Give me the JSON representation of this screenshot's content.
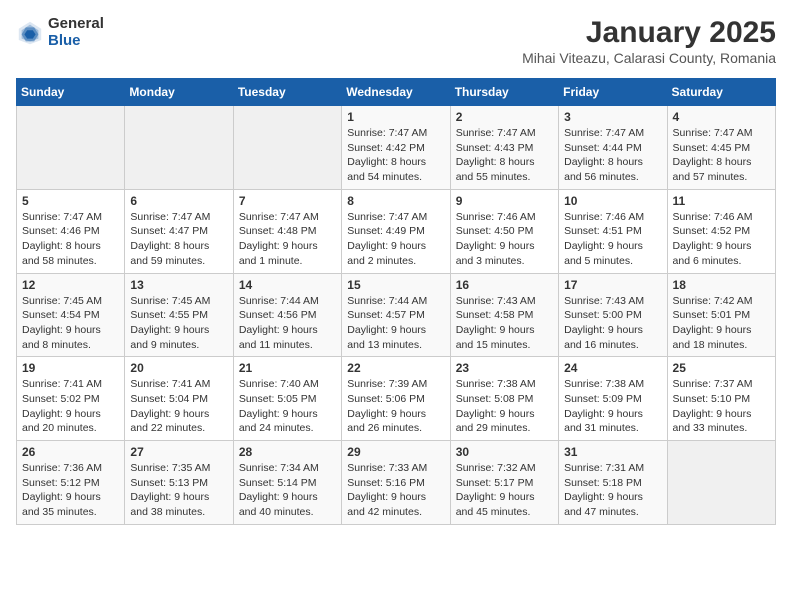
{
  "logo": {
    "general": "General",
    "blue": "Blue"
  },
  "header": {
    "month_title": "January 2025",
    "subtitle": "Mihai Viteazu, Calarasi County, Romania"
  },
  "weekdays": [
    "Sunday",
    "Monday",
    "Tuesday",
    "Wednesday",
    "Thursday",
    "Friday",
    "Saturday"
  ],
  "weeks": [
    [
      {
        "day": "",
        "content": ""
      },
      {
        "day": "",
        "content": ""
      },
      {
        "day": "",
        "content": ""
      },
      {
        "day": "1",
        "content": "Sunrise: 7:47 AM\nSunset: 4:42 PM\nDaylight: 8 hours\nand 54 minutes."
      },
      {
        "day": "2",
        "content": "Sunrise: 7:47 AM\nSunset: 4:43 PM\nDaylight: 8 hours\nand 55 minutes."
      },
      {
        "day": "3",
        "content": "Sunrise: 7:47 AM\nSunset: 4:44 PM\nDaylight: 8 hours\nand 56 minutes."
      },
      {
        "day": "4",
        "content": "Sunrise: 7:47 AM\nSunset: 4:45 PM\nDaylight: 8 hours\nand 57 minutes."
      }
    ],
    [
      {
        "day": "5",
        "content": "Sunrise: 7:47 AM\nSunset: 4:46 PM\nDaylight: 8 hours\nand 58 minutes."
      },
      {
        "day": "6",
        "content": "Sunrise: 7:47 AM\nSunset: 4:47 PM\nDaylight: 8 hours\nand 59 minutes."
      },
      {
        "day": "7",
        "content": "Sunrise: 7:47 AM\nSunset: 4:48 PM\nDaylight: 9 hours\nand 1 minute."
      },
      {
        "day": "8",
        "content": "Sunrise: 7:47 AM\nSunset: 4:49 PM\nDaylight: 9 hours\nand 2 minutes."
      },
      {
        "day": "9",
        "content": "Sunrise: 7:46 AM\nSunset: 4:50 PM\nDaylight: 9 hours\nand 3 minutes."
      },
      {
        "day": "10",
        "content": "Sunrise: 7:46 AM\nSunset: 4:51 PM\nDaylight: 9 hours\nand 5 minutes."
      },
      {
        "day": "11",
        "content": "Sunrise: 7:46 AM\nSunset: 4:52 PM\nDaylight: 9 hours\nand 6 minutes."
      }
    ],
    [
      {
        "day": "12",
        "content": "Sunrise: 7:45 AM\nSunset: 4:54 PM\nDaylight: 9 hours\nand 8 minutes."
      },
      {
        "day": "13",
        "content": "Sunrise: 7:45 AM\nSunset: 4:55 PM\nDaylight: 9 hours\nand 9 minutes."
      },
      {
        "day": "14",
        "content": "Sunrise: 7:44 AM\nSunset: 4:56 PM\nDaylight: 9 hours\nand 11 minutes."
      },
      {
        "day": "15",
        "content": "Sunrise: 7:44 AM\nSunset: 4:57 PM\nDaylight: 9 hours\nand 13 minutes."
      },
      {
        "day": "16",
        "content": "Sunrise: 7:43 AM\nSunset: 4:58 PM\nDaylight: 9 hours\nand 15 minutes."
      },
      {
        "day": "17",
        "content": "Sunrise: 7:43 AM\nSunset: 5:00 PM\nDaylight: 9 hours\nand 16 minutes."
      },
      {
        "day": "18",
        "content": "Sunrise: 7:42 AM\nSunset: 5:01 PM\nDaylight: 9 hours\nand 18 minutes."
      }
    ],
    [
      {
        "day": "19",
        "content": "Sunrise: 7:41 AM\nSunset: 5:02 PM\nDaylight: 9 hours\nand 20 minutes."
      },
      {
        "day": "20",
        "content": "Sunrise: 7:41 AM\nSunset: 5:04 PM\nDaylight: 9 hours\nand 22 minutes."
      },
      {
        "day": "21",
        "content": "Sunrise: 7:40 AM\nSunset: 5:05 PM\nDaylight: 9 hours\nand 24 minutes."
      },
      {
        "day": "22",
        "content": "Sunrise: 7:39 AM\nSunset: 5:06 PM\nDaylight: 9 hours\nand 26 minutes."
      },
      {
        "day": "23",
        "content": "Sunrise: 7:38 AM\nSunset: 5:08 PM\nDaylight: 9 hours\nand 29 minutes."
      },
      {
        "day": "24",
        "content": "Sunrise: 7:38 AM\nSunset: 5:09 PM\nDaylight: 9 hours\nand 31 minutes."
      },
      {
        "day": "25",
        "content": "Sunrise: 7:37 AM\nSunset: 5:10 PM\nDaylight: 9 hours\nand 33 minutes."
      }
    ],
    [
      {
        "day": "26",
        "content": "Sunrise: 7:36 AM\nSunset: 5:12 PM\nDaylight: 9 hours\nand 35 minutes."
      },
      {
        "day": "27",
        "content": "Sunrise: 7:35 AM\nSunset: 5:13 PM\nDaylight: 9 hours\nand 38 minutes."
      },
      {
        "day": "28",
        "content": "Sunrise: 7:34 AM\nSunset: 5:14 PM\nDaylight: 9 hours\nand 40 minutes."
      },
      {
        "day": "29",
        "content": "Sunrise: 7:33 AM\nSunset: 5:16 PM\nDaylight: 9 hours\nand 42 minutes."
      },
      {
        "day": "30",
        "content": "Sunrise: 7:32 AM\nSunset: 5:17 PM\nDaylight: 9 hours\nand 45 minutes."
      },
      {
        "day": "31",
        "content": "Sunrise: 7:31 AM\nSunset: 5:18 PM\nDaylight: 9 hours\nand 47 minutes."
      },
      {
        "day": "",
        "content": ""
      }
    ]
  ]
}
